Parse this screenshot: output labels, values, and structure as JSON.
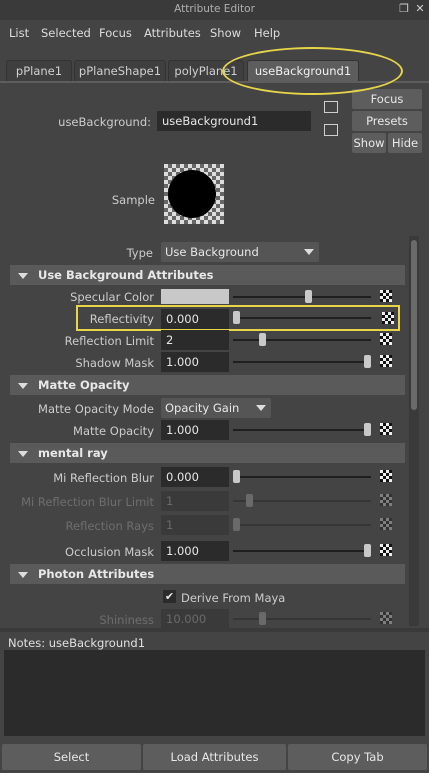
{
  "window": {
    "title": "Attribute Editor"
  },
  "menu": [
    "List",
    "Selected",
    "Focus",
    "Attributes",
    "Show",
    "Help"
  ],
  "tabs": [
    "pPlane1",
    "pPlaneShape1",
    "polyPlane1",
    "useBackground1"
  ],
  "node": {
    "label": "useBackground:",
    "value": "useBackground1"
  },
  "side_buttons": {
    "focus": "Focus",
    "presets": "Presets",
    "show": "Show",
    "hide": "Hide"
  },
  "sample_label": "Sample",
  "type": {
    "label": "Type",
    "value": "Use Background"
  },
  "sections": {
    "use_bg": "Use Background Attributes",
    "matte": "Matte Opacity",
    "mental_ray": "mental ray",
    "photon": "Photon Attributes"
  },
  "attrs": {
    "specular_color": {
      "label": "Specular Color",
      "slider": 0.55
    },
    "reflectivity": {
      "label": "Reflectivity",
      "value": "0.000",
      "slider": 0.0
    },
    "reflection_limit": {
      "label": "Reflection Limit",
      "value": "2",
      "slider": 0.2
    },
    "shadow_mask": {
      "label": "Shadow Mask",
      "value": "1.000",
      "slider": 1.0
    },
    "matte_mode": {
      "label": "Matte Opacity Mode",
      "value": "Opacity Gain"
    },
    "matte_opacity": {
      "label": "Matte Opacity",
      "value": "1.000",
      "slider": 1.0
    },
    "mi_reflection_blur": {
      "label": "Mi Reflection Blur",
      "value": "0.000",
      "slider": 0.0
    },
    "mi_reflection_blur_limit": {
      "label": "Mi Reflection Blur Limit",
      "value": "1",
      "slider": 0.1
    },
    "reflection_rays": {
      "label": "Reflection Rays",
      "value": "1",
      "slider": 0.0
    },
    "occlusion_mask": {
      "label": "Occlusion Mask",
      "value": "1.000",
      "slider": 1.0
    },
    "derive_from_maya": {
      "label": "Derive From Maya",
      "checked": true
    },
    "shininess": {
      "label": "Shininess",
      "value": "10.000",
      "slider": 0.2
    }
  },
  "notes": {
    "label": "Notes:  useBackground1"
  },
  "bottom": {
    "select": "Select",
    "load": "Load Attributes",
    "copy": "Copy Tab"
  },
  "colors": {
    "highlight": "#e6d44a",
    "panel": "#444444",
    "field": "#2b2b2b"
  }
}
